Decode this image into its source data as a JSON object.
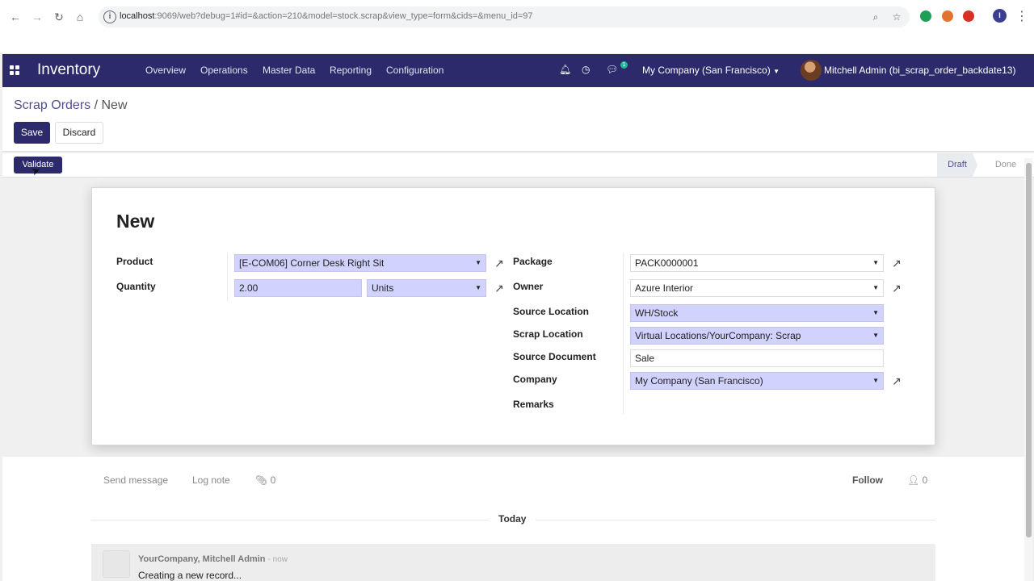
{
  "browser": {
    "url_host": "localhost",
    "url_rest": ":9069/web?debug=1#id=&action=210&model=stock.scrap&view_type=form&cids=&menu_id=97",
    "profile_initial": "I",
    "colors": {
      "ext_green": "#1e9e57",
      "ext_orange": "#e0732e",
      "ext_red": "#d93025",
      "profile": "#3c3f8f"
    }
  },
  "navbar": {
    "brand": "Inventory",
    "menu": [
      "Overview",
      "Operations",
      "Master Data",
      "Reporting",
      "Configuration"
    ],
    "chat_count": "1",
    "company": "My Company (San Francisco)",
    "user": "Mitchell Admin (bi_scrap_order_backdate13)",
    "colors": {
      "background": "#2c2a6b",
      "badge": "#21b799"
    }
  },
  "control_panel": {
    "breadcrumb_parent": "Scrap Orders",
    "breadcrumb_separator": " / ",
    "breadcrumb_current": "New",
    "save_label": "Save",
    "discard_label": "Discard"
  },
  "statusbar": {
    "validate_label": "Validate",
    "stages": [
      "Draft",
      "Done"
    ],
    "active_stage": "Draft"
  },
  "form": {
    "title": "New",
    "left": {
      "product_label": "Product",
      "product_value": "[E-COM06] Corner Desk Right Sit",
      "quantity_label": "Quantity",
      "quantity_value": "2.00",
      "uom_value": "Units"
    },
    "right": {
      "package_label": "Package",
      "package_value": "PACK0000001",
      "owner_label": "Owner",
      "owner_value": "Azure Interior",
      "source_location_label": "Source Location",
      "source_location_value": "WH/Stock",
      "scrap_location_label": "Scrap Location",
      "scrap_location_value": "Virtual Locations/YourCompany: Scrap",
      "source_document_label": "Source Document",
      "source_document_value": "Sale",
      "company_label": "Company",
      "company_value": "My Company (San Francisco)",
      "remarks_label": "Remarks",
      "remarks_value": ""
    },
    "colors": {
      "required_field": "#d2d2ff"
    }
  },
  "chatter": {
    "send_message": "Send message",
    "log_note": "Log note",
    "attachments": "0",
    "follow": "Follow",
    "followers": "0",
    "date_separator": "Today",
    "message": {
      "author": "YourCompany, Mitchell Admin",
      "date": "- now",
      "body": "Creating a new record..."
    }
  }
}
